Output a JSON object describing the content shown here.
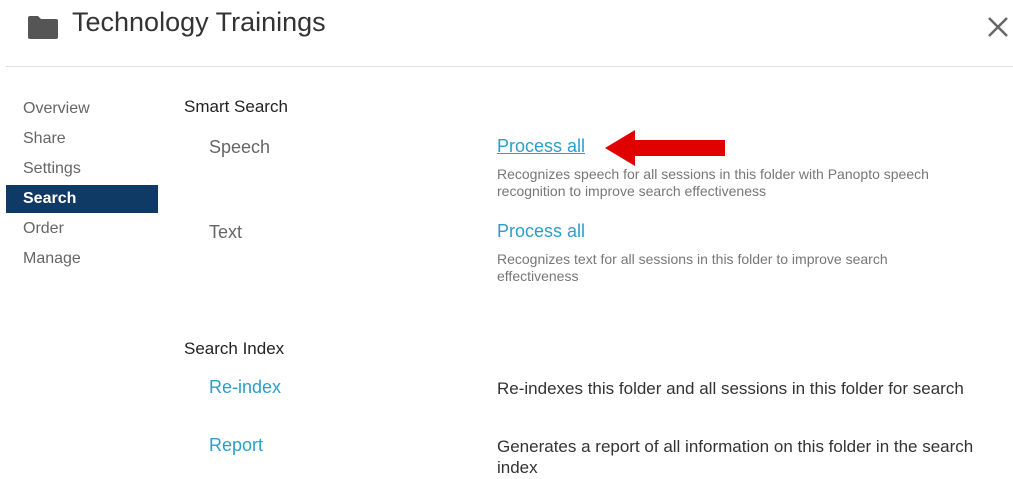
{
  "header": {
    "title": "Technology Trainings",
    "folder_icon": "folder-icon",
    "close_icon": "close-icon"
  },
  "sidebar": {
    "items": [
      {
        "label": "Overview",
        "active": false
      },
      {
        "label": "Share",
        "active": false
      },
      {
        "label": "Settings",
        "active": false
      },
      {
        "label": "Search",
        "active": true
      },
      {
        "label": "Order",
        "active": false
      },
      {
        "label": "Manage",
        "active": false
      }
    ]
  },
  "smart_search": {
    "heading": "Smart Search",
    "speech": {
      "label": "Speech",
      "action": "Process all",
      "description": "Recognizes speech for all sessions in this folder with Panopto speech recognition to improve search effectiveness"
    },
    "text": {
      "label": "Text",
      "action": "Process all",
      "description": "Recognizes text for all sessions in this folder to improve search effectiveness"
    }
  },
  "search_index": {
    "heading": "Search Index",
    "reindex": {
      "action": "Re-index",
      "description": "Re-indexes this folder and all sessions in this folder for search"
    },
    "report": {
      "action": "Report",
      "description": "Generates a report of all information on this folder in the search index"
    }
  },
  "colors": {
    "accent": "#0f3a66",
    "link": "#2a9fc9",
    "arrow": "#e10000"
  }
}
